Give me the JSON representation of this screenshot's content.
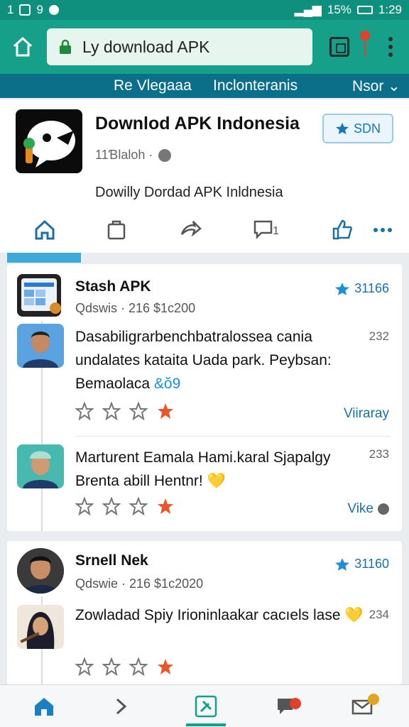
{
  "status_bar": {
    "left_text": "1",
    "left_num": "9",
    "battery": "15%",
    "time": "1:29"
  },
  "browser": {
    "url": "Ly download APK"
  },
  "tabs": [
    {
      "label": "Re Vlegaaa"
    },
    {
      "label": "Inclonteranis"
    },
    {
      "label": "Nsor ⌄"
    }
  ],
  "profile": {
    "title": "Downlod APK Indonesia",
    "meta": "11Ɓlaloh ·",
    "description": "Dowilly Dordad APK Inldnesia",
    "follow_label": "SDN"
  },
  "posts": [
    {
      "app_name": "Stash APK",
      "app_meta": "Qdswis · 216  $1c200",
      "score": "31166",
      "comments": [
        {
          "text": "Dasabiligrarbenchbatralossea cania undalates kataita Uada park. Peybsan: Bemaolaca",
          "emoji": "&ŏ9",
          "num": "232",
          "link": "Viiraray"
        },
        {
          "text": "Marturent Eamala Hami.karal Sjapalgy Brenta abill Hentnr!",
          "emoji": "💛",
          "num": "233",
          "link": "Vike"
        }
      ]
    },
    {
      "app_name": "Srnell Nek",
      "app_meta": "Qdswie · 216  $1c2020",
      "score": "31160",
      "comments": [
        {
          "text": "Zowladad Spiy Irioninlaakar cacıels lase",
          "emoji": "💛",
          "num": "234"
        }
      ]
    }
  ],
  "colors": {
    "status": "#0f8f7e",
    "browser": "#16a08a",
    "tabs": "#0b6f8a",
    "accent": "#1b6fa8"
  }
}
